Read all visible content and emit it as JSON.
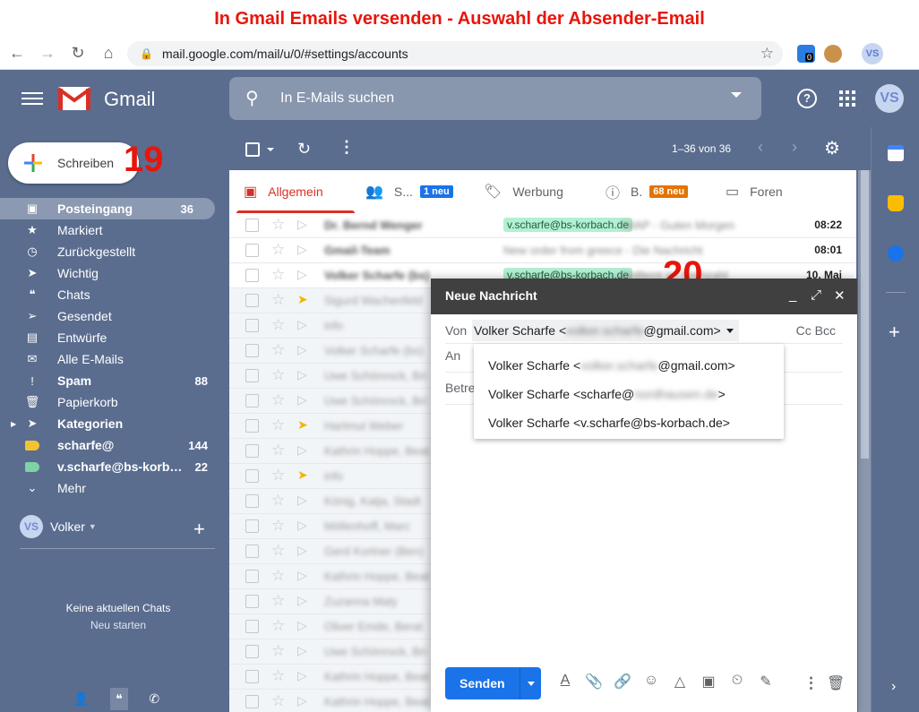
{
  "banner": {
    "title": "In Gmail Emails versenden - Auswahl der Absender-Email"
  },
  "browser": {
    "url": "mail.google.com/mail/u/0/#settings/accounts",
    "ext_badge": "0",
    "avatar_initials": "VS"
  },
  "gmail": {
    "logo_word": "Gmail",
    "search_placeholder": "In E-Mails suchen",
    "help_glyph": "?",
    "avatar_initials": "VS"
  },
  "compose_button": {
    "label": "Schreiben"
  },
  "annotations": {
    "step1": "19",
    "step2": "20"
  },
  "nav": [
    {
      "label": "Posteingang",
      "count": "36",
      "icon": "inbox-icon",
      "active": true,
      "bold": true
    },
    {
      "label": "Markiert",
      "count": "",
      "icon": "star-icon"
    },
    {
      "label": "Zurückgestellt",
      "count": "",
      "icon": "clock-icon"
    },
    {
      "label": "Wichtig",
      "count": "",
      "icon": "important-icon"
    },
    {
      "label": "Chats",
      "count": "",
      "icon": "chat-icon"
    },
    {
      "label": "Gesendet",
      "count": "",
      "icon": "send-icon"
    },
    {
      "label": "Entwürfe",
      "count": "",
      "icon": "draft-icon"
    },
    {
      "label": "Alle E-Mails",
      "count": "",
      "icon": "mail-icon"
    },
    {
      "label": "Spam",
      "count": "88",
      "icon": "spam-icon",
      "bold": true
    },
    {
      "label": "Papierkorb",
      "count": "",
      "icon": "trash-icon"
    },
    {
      "label": "Kategorien",
      "count": "",
      "icon": "label-icon",
      "bold": true
    },
    {
      "label": "scharfe@",
      "count": "144",
      "icon": "label-yellow-icon",
      "bold": true
    },
    {
      "label": "v.scharfe@bs-korb…",
      "count": "22",
      "icon": "label-green-icon",
      "bold": true
    },
    {
      "label": "Mehr",
      "count": "",
      "icon": "chevron-down-icon"
    }
  ],
  "hangouts": {
    "user_initials": "VS",
    "user_name": "Volker",
    "no_chats": "Keine aktuellen Chats",
    "start_new": "Neu starten"
  },
  "toolbar": {
    "pager": "1–36 von 36"
  },
  "tabs": [
    {
      "label": "Allgemein",
      "icon": "inbox-tab-icon",
      "badge": "",
      "badge_color": ""
    },
    {
      "label": "S...",
      "icon": "social-icon",
      "badge": "1 neu",
      "badge_color": "#1a73e8"
    },
    {
      "label": "Werbung",
      "icon": "tag-icon",
      "badge": "",
      "badge_color": ""
    },
    {
      "label": "B.",
      "icon": "info-icon",
      "badge": "68 neu",
      "badge_color": "#e37400"
    },
    {
      "label": "Foren",
      "icon": "forum-icon",
      "badge": "",
      "badge_color": ""
    }
  ],
  "mails": [
    {
      "sender": "Dr. Bernd Wenger",
      "label": "v.scharfe@bs-korbach.de",
      "subject": "IMAP - Guten Morgen",
      "date": "08:22",
      "unread": true,
      "imp": false
    },
    {
      "sender": "Gmail-Team",
      "label": "",
      "subject": "New order from greece - Die Nachricht",
      "date": "08:01",
      "unread": true,
      "imp": false
    },
    {
      "sender": "Volker Scharfe (bs)",
      "label": "v.scharfe@bs-korbach.de",
      "subject": "Entfernt im Drehzahl",
      "date": "10. Mai",
      "unread": true,
      "imp": false
    },
    {
      "sender": "Sigurd Wachenfeld",
      "label": "",
      "subject": "",
      "date": "",
      "unread": false,
      "imp": true
    },
    {
      "sender": "info",
      "label": "",
      "subject": "",
      "date": "",
      "unread": false,
      "imp": false
    },
    {
      "sender": "Volker Scharfe (bs)",
      "label": "",
      "subject": "",
      "date": "",
      "unread": false,
      "imp": false
    },
    {
      "sender": "Uwe Schönrock, Bri",
      "label": "",
      "subject": "",
      "date": "",
      "unread": false,
      "imp": false
    },
    {
      "sender": "Uwe Schönrock, Bri",
      "label": "",
      "subject": "",
      "date": "",
      "unread": false,
      "imp": false
    },
    {
      "sender": "Hartmut Weber",
      "label": "",
      "subject": "",
      "date": "",
      "unread": false,
      "imp": true
    },
    {
      "sender": "Kathrin Hoppe, Beat",
      "label": "",
      "subject": "",
      "date": "",
      "unread": false,
      "imp": false
    },
    {
      "sender": "info",
      "label": "",
      "subject": "",
      "date": "",
      "unread": false,
      "imp": true
    },
    {
      "sender": "König, Katja, Stadt",
      "label": "",
      "subject": "",
      "date": "",
      "unread": false,
      "imp": false
    },
    {
      "sender": "Möllenhoff, Marc",
      "label": "",
      "subject": "",
      "date": "",
      "unread": false,
      "imp": false
    },
    {
      "sender": "Gerd Kortner (Ben)",
      "label": "",
      "subject": "",
      "date": "",
      "unread": false,
      "imp": false
    },
    {
      "sender": "Kathrin Hoppe, Beat",
      "label": "",
      "subject": "",
      "date": "",
      "unread": false,
      "imp": false
    },
    {
      "sender": "Zuzanna Maly",
      "label": "",
      "subject": "",
      "date": "",
      "unread": false,
      "imp": false
    },
    {
      "sender": "Oliver Emde, Berat",
      "label": "",
      "subject": "",
      "date": "",
      "unread": false,
      "imp": false
    },
    {
      "sender": "Uwe Schönrock, Bri",
      "label": "",
      "subject": "",
      "date": "",
      "unread": false,
      "imp": false
    },
    {
      "sender": "Kathrin Hoppe, Beat",
      "label": "",
      "subject": "",
      "date": "",
      "unread": false,
      "imp": false
    },
    {
      "sender": "Kathrin Hoppe, Beat",
      "label": "",
      "subject": "",
      "date": "",
      "unread": false,
      "imp": false
    }
  ],
  "compose": {
    "title": "Neue Nachricht",
    "from_label": "Von",
    "from_name": "Volker Scharfe <",
    "from_blur": "volker.scharfe",
    "from_domain": "@gmail.com>",
    "cc_bcc": "Cc Bcc",
    "to_label": "An",
    "subject_label": "Betreff",
    "send_label": "Senden",
    "options": [
      {
        "prefix": "Volker Scharfe <",
        "blur": "volker.scharfe",
        "suffix": "@gmail.com>"
      },
      {
        "prefix": "Volker Scharfe <scharfe@",
        "blur": "nordhausen.de",
        "suffix": ">"
      },
      {
        "prefix": "Volker Scharfe <v.scharfe@bs-korbach.de>",
        "blur": "",
        "suffix": ""
      }
    ]
  },
  "colors": {
    "accent_red": "#e8150b",
    "gmail_bg": "#5a6d8f",
    "send_blue": "#1a73e8",
    "label_yellow": "#f4c430",
    "label_green": "#7ed3a6"
  }
}
